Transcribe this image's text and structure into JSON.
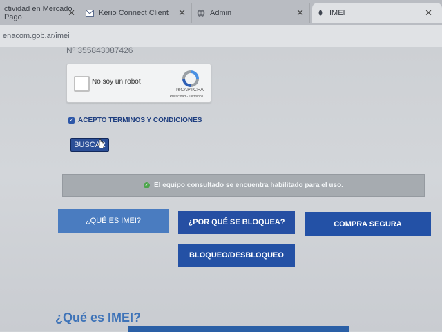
{
  "browser": {
    "tabs": [
      {
        "title": "ctividad en Mercado Pago",
        "icon": "handshake-icon",
        "close": "✕"
      },
      {
        "title": "Kerio Connect Client",
        "icon": "mail-icon",
        "close": "✕"
      },
      {
        "title": "Admin",
        "icon": "globe-icon",
        "close": "✕"
      },
      {
        "title": "IMEI",
        "icon": "shield-icon",
        "close": "✕"
      }
    ],
    "address": "enacom.gob.ar/imei"
  },
  "form": {
    "imei_value": "Nº 355843087426",
    "captcha_label": "No soy un robot",
    "captcha_brand": "reCAPTCHA",
    "captcha_links": "Privacidad - Términos",
    "terms_label": "ACEPTO TERMINOS Y CONDICIONES",
    "terms_checked": true,
    "search_label": "BUSCAR"
  },
  "alert": {
    "message": "El equipo consultado se encuentra habilitado para el uso.",
    "color": "#4ca54c"
  },
  "actions": {
    "what_is": "¿QUÉ ES IMEI?",
    "why_blocked": "¿POR QUÉ SE BLOQUEA?",
    "safe_purchase": "COMPRA SEGURA",
    "block_unblock": "BLOQUEO/DESBLOQUEO"
  },
  "section": {
    "heading": "¿Qué es IMEI?"
  },
  "colors": {
    "primary_blue": "#264fa3",
    "light_blue": "#4a7cc0",
    "heading_blue": "#3e73b8"
  }
}
